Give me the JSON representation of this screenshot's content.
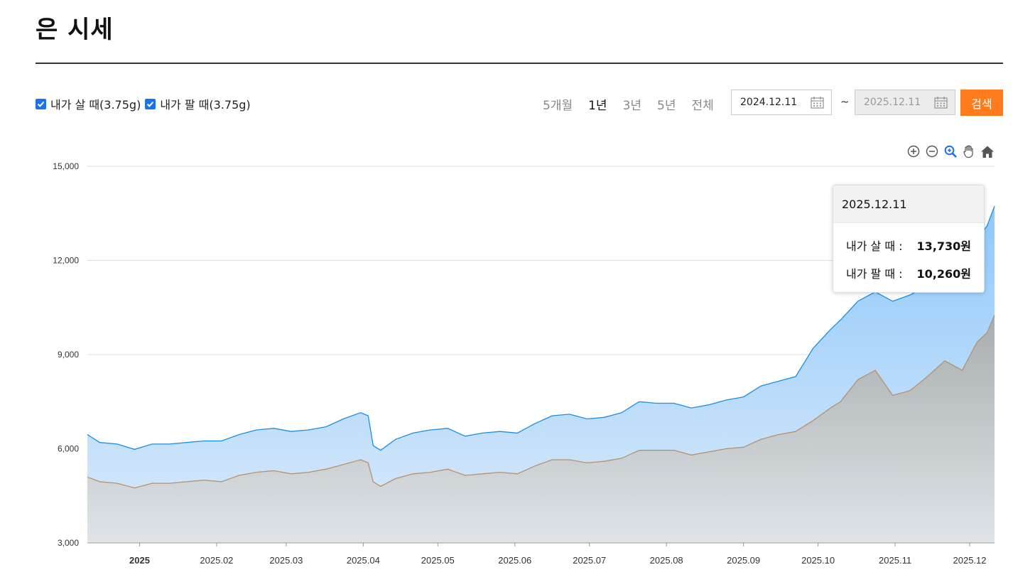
{
  "page": {
    "title": "은 시세"
  },
  "filters": {
    "buy_label": "내가 살 때(3.75g)",
    "sell_label": "내가 팔 때(3.75g)"
  },
  "periods": [
    {
      "label": "5개월",
      "active": false
    },
    {
      "label": "1년",
      "active": true
    },
    {
      "label": "3년",
      "active": false
    },
    {
      "label": "5년",
      "active": false
    },
    {
      "label": "전체",
      "active": false
    }
  ],
  "date_range": {
    "start": "2024.12.11",
    "separator": "~",
    "end": "2025.12.11"
  },
  "search_label": "검색",
  "toolbar_icons": [
    "zoom-in-icon",
    "zoom-out-icon",
    "magnify-icon",
    "pan-hand-icon",
    "home-icon"
  ],
  "tooltip": {
    "date": "2025.12.11",
    "buy_label": "내가 살 때 :",
    "buy_value": "13,730원",
    "sell_label": "내가 팔 때 :",
    "sell_value": "10,260원"
  },
  "colors": {
    "buy_line": "#1a8fe3",
    "sell_line": "#b8916c",
    "accent": "#ff7b1c"
  },
  "chart_data": {
    "type": "area",
    "title": "",
    "xlabel": "",
    "ylabel": "",
    "ylim": [
      3000,
      15000
    ],
    "yticks": [
      3000,
      6000,
      9000,
      12000,
      15000
    ],
    "ytick_labels": [
      "3,000",
      "6,000",
      "9,000",
      "12,000",
      "15,000"
    ],
    "xlim": [
      "2024-12-11",
      "2025-12-11"
    ],
    "xticks": [
      {
        "date": "2025-01-01",
        "label": "2025",
        "bold": true
      },
      {
        "date": "2025-02-01",
        "label": "2025.02"
      },
      {
        "date": "2025-03-01",
        "label": "2025.03"
      },
      {
        "date": "2025-04-01",
        "label": "2025.04"
      },
      {
        "date": "2025-05-01",
        "label": "2025.05"
      },
      {
        "date": "2025-06-01",
        "label": "2025.06"
      },
      {
        "date": "2025-07-01",
        "label": "2025.07"
      },
      {
        "date": "2025-08-01",
        "label": "2025.08"
      },
      {
        "date": "2025-09-01",
        "label": "2025.09"
      },
      {
        "date": "2025-10-01",
        "label": "2025.10"
      },
      {
        "date": "2025-11-01",
        "label": "2025.11"
      },
      {
        "date": "2025-12-01",
        "label": "2025.12"
      }
    ],
    "grid": true,
    "series": [
      {
        "name": "내가 살 때(3.75g)",
        "points": [
          [
            "2024-12-11",
            6450
          ],
          [
            "2024-12-16",
            6200
          ],
          [
            "2024-12-23",
            6150
          ],
          [
            "2024-12-30",
            5980
          ],
          [
            "2025-01-06",
            6150
          ],
          [
            "2025-01-13",
            6150
          ],
          [
            "2025-01-20",
            6200
          ],
          [
            "2025-01-27",
            6250
          ],
          [
            "2025-02-03",
            6250
          ],
          [
            "2025-02-10",
            6450
          ],
          [
            "2025-02-17",
            6600
          ],
          [
            "2025-02-24",
            6650
          ],
          [
            "2025-03-03",
            6550
          ],
          [
            "2025-03-10",
            6600
          ],
          [
            "2025-03-17",
            6700
          ],
          [
            "2025-03-24",
            6950
          ],
          [
            "2025-03-31",
            7150
          ],
          [
            "2025-04-03",
            7050
          ],
          [
            "2025-04-05",
            6100
          ],
          [
            "2025-04-08",
            5950
          ],
          [
            "2025-04-14",
            6300
          ],
          [
            "2025-04-21",
            6500
          ],
          [
            "2025-04-28",
            6600
          ],
          [
            "2025-05-05",
            6650
          ],
          [
            "2025-05-12",
            6400
          ],
          [
            "2025-05-19",
            6500
          ],
          [
            "2025-05-26",
            6550
          ],
          [
            "2025-06-02",
            6500
          ],
          [
            "2025-06-09",
            6800
          ],
          [
            "2025-06-16",
            7050
          ],
          [
            "2025-06-23",
            7100
          ],
          [
            "2025-06-30",
            6950
          ],
          [
            "2025-07-07",
            7000
          ],
          [
            "2025-07-14",
            7150
          ],
          [
            "2025-07-21",
            7500
          ],
          [
            "2025-07-28",
            7450
          ],
          [
            "2025-08-04",
            7450
          ],
          [
            "2025-08-11",
            7300
          ],
          [
            "2025-08-18",
            7400
          ],
          [
            "2025-08-25",
            7550
          ],
          [
            "2025-09-01",
            7650
          ],
          [
            "2025-09-08",
            8000
          ],
          [
            "2025-09-15",
            8150
          ],
          [
            "2025-09-22",
            8300
          ],
          [
            "2025-09-29",
            9200
          ],
          [
            "2025-10-06",
            9800
          ],
          [
            "2025-10-10",
            10100
          ],
          [
            "2025-10-17",
            10700
          ],
          [
            "2025-10-24",
            11000
          ],
          [
            "2025-10-31",
            10700
          ],
          [
            "2025-11-07",
            10900
          ],
          [
            "2025-11-14",
            11200
          ],
          [
            "2025-11-21",
            11150
          ],
          [
            "2025-11-28",
            12000
          ],
          [
            "2025-12-04",
            12700
          ],
          [
            "2025-12-08",
            13100
          ],
          [
            "2025-12-11",
            13730
          ]
        ]
      },
      {
        "name": "내가 팔 때(3.75g)",
        "points": [
          [
            "2024-12-11",
            5100
          ],
          [
            "2024-12-16",
            4950
          ],
          [
            "2024-12-23",
            4900
          ],
          [
            "2024-12-30",
            4750
          ],
          [
            "2025-01-06",
            4900
          ],
          [
            "2025-01-13",
            4900
          ],
          [
            "2025-01-20",
            4950
          ],
          [
            "2025-01-27",
            5000
          ],
          [
            "2025-02-03",
            4950
          ],
          [
            "2025-02-10",
            5150
          ],
          [
            "2025-02-17",
            5250
          ],
          [
            "2025-02-24",
            5300
          ],
          [
            "2025-03-03",
            5200
          ],
          [
            "2025-03-10",
            5250
          ],
          [
            "2025-03-17",
            5350
          ],
          [
            "2025-03-24",
            5500
          ],
          [
            "2025-03-31",
            5650
          ],
          [
            "2025-04-03",
            5550
          ],
          [
            "2025-04-05",
            4950
          ],
          [
            "2025-04-08",
            4800
          ],
          [
            "2025-04-14",
            5050
          ],
          [
            "2025-04-21",
            5200
          ],
          [
            "2025-04-28",
            5250
          ],
          [
            "2025-05-05",
            5350
          ],
          [
            "2025-05-12",
            5150
          ],
          [
            "2025-05-19",
            5200
          ],
          [
            "2025-05-26",
            5250
          ],
          [
            "2025-06-02",
            5200
          ],
          [
            "2025-06-09",
            5450
          ],
          [
            "2025-06-16",
            5650
          ],
          [
            "2025-06-23",
            5650
          ],
          [
            "2025-06-30",
            5550
          ],
          [
            "2025-07-07",
            5600
          ],
          [
            "2025-07-14",
            5700
          ],
          [
            "2025-07-21",
            5950
          ],
          [
            "2025-07-28",
            5950
          ],
          [
            "2025-08-04",
            5950
          ],
          [
            "2025-08-11",
            5800
          ],
          [
            "2025-08-18",
            5900
          ],
          [
            "2025-08-25",
            6000
          ],
          [
            "2025-09-01",
            6050
          ],
          [
            "2025-09-08",
            6300
          ],
          [
            "2025-09-15",
            6450
          ],
          [
            "2025-09-22",
            6550
          ],
          [
            "2025-09-29",
            6900
          ],
          [
            "2025-10-06",
            7300
          ],
          [
            "2025-10-10",
            7500
          ],
          [
            "2025-10-17",
            8200
          ],
          [
            "2025-10-24",
            8500
          ],
          [
            "2025-10-31",
            7700
          ],
          [
            "2025-11-07",
            7850
          ],
          [
            "2025-11-14",
            8300
          ],
          [
            "2025-11-21",
            8800
          ],
          [
            "2025-11-28",
            8500
          ],
          [
            "2025-12-04",
            9400
          ],
          [
            "2025-12-08",
            9700
          ],
          [
            "2025-12-11",
            10260
          ]
        ]
      }
    ]
  }
}
